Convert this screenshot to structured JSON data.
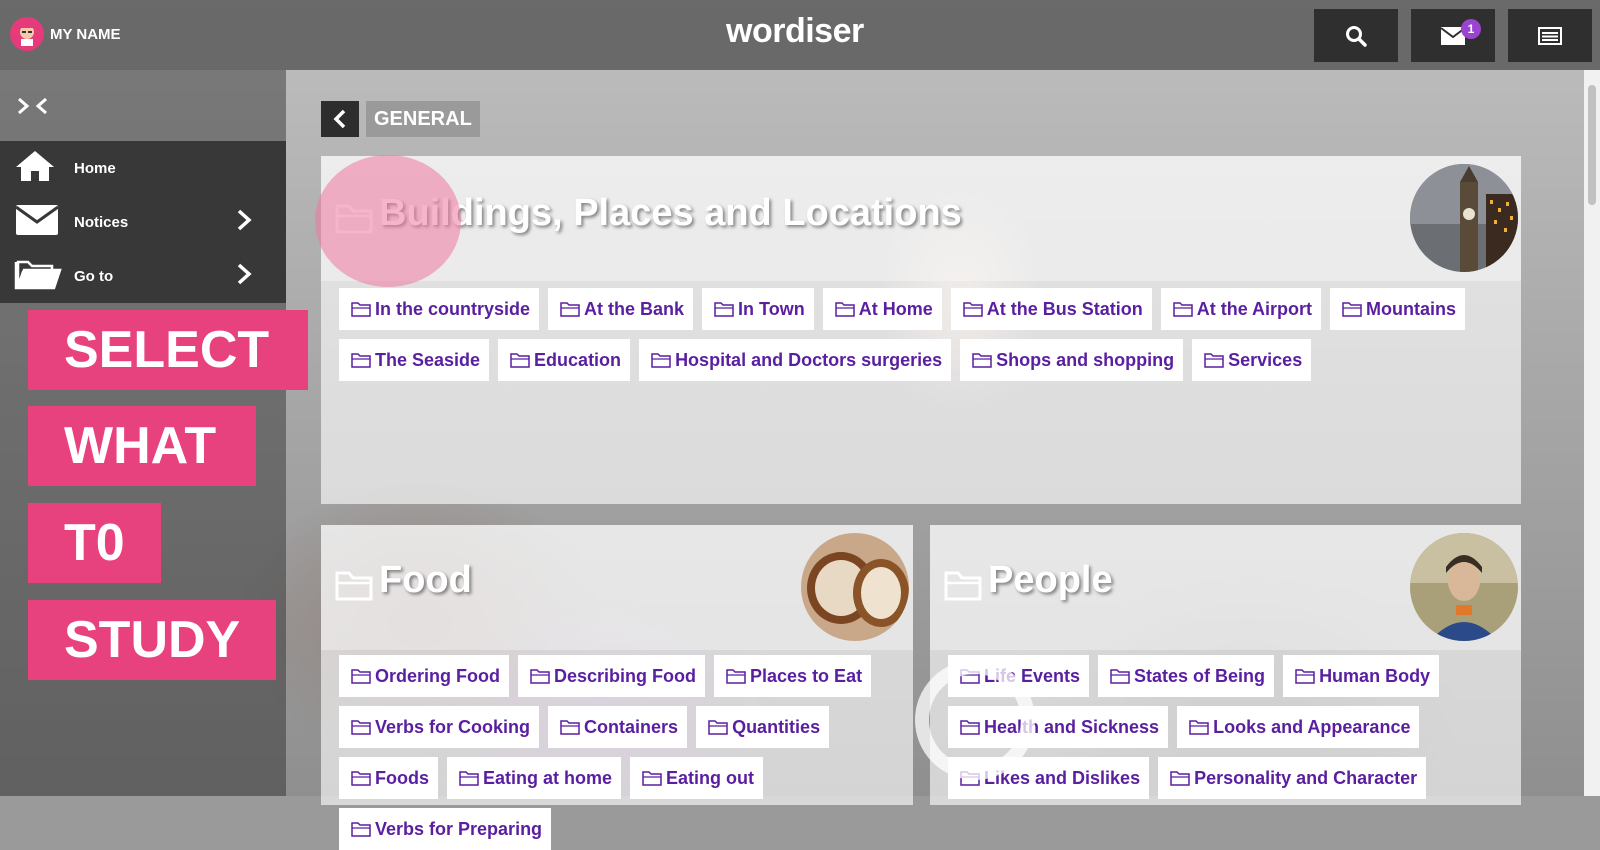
{
  "header": {
    "user_name": "MY NAME",
    "logo": "wordiser",
    "notifications_count": "1",
    "icons": [
      "search-icon",
      "envelope-icon",
      "list-icon"
    ]
  },
  "sidebar": {
    "collapse_icon": "collapse-arrows-icon",
    "menu": [
      {
        "label": "Home",
        "icon": "home-icon"
      },
      {
        "label": "Notices",
        "icon": "envelope-icon"
      },
      {
        "label": "Go to",
        "icon": "folder-open-icon"
      }
    ],
    "tags": [
      "SELECT",
      "WHAT",
      "T0",
      "STUDY"
    ]
  },
  "breadcrumb": {
    "current": "GENERAL"
  },
  "cards": [
    {
      "title": "Buildings, Places and Locations",
      "items": [
        "In the countryside",
        "At the Bank",
        "In Town",
        "At Home",
        "At the Bus Station",
        "At the Airport",
        "Mountains",
        "The Seaside",
        "Education",
        "Hospital and Doctors surgeries",
        "Shops and shopping",
        "Services"
      ]
    },
    {
      "title": "Food",
      "items": [
        "Ordering Food",
        "Describing Food",
        "Places to Eat",
        "Verbs for Cooking",
        "Containers",
        "Quantities",
        "Foods",
        "Eating at home",
        "Eating out",
        "Verbs for Preparing"
      ]
    },
    {
      "title": "People",
      "items": [
        "Life Events",
        "States of Being",
        "Human Body",
        "Health and Sickness",
        "Looks and Appearance",
        "Likes and Dislikes",
        "Personality and Character"
      ]
    }
  ],
  "colors": {
    "accent_pink": "#e8427e",
    "link_purple": "#5a1fa0",
    "badge_purple": "#9b44d1",
    "dark_button": "#2f2f2f"
  }
}
